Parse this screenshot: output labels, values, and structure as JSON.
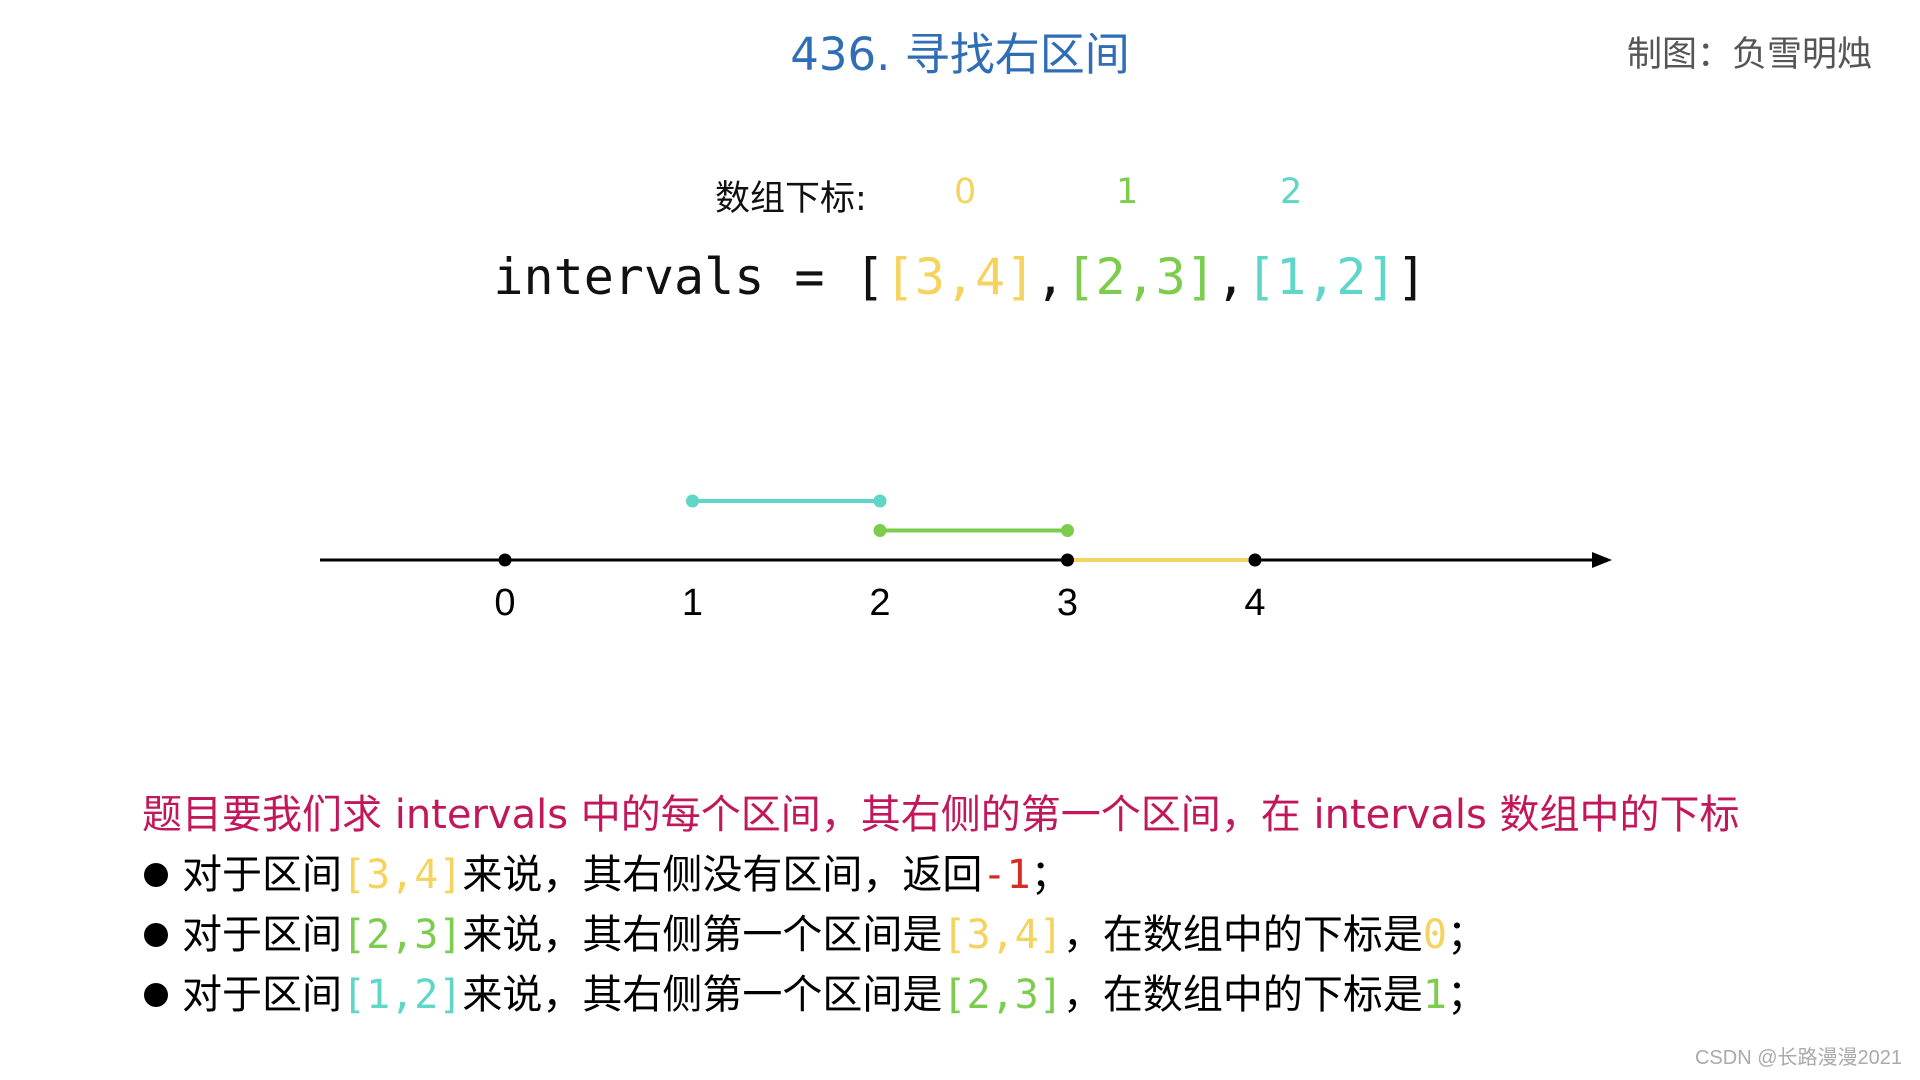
{
  "header": {
    "title": "436. 寻找右区间",
    "author": "制图：负雪明烛"
  },
  "index_label": "数组下标:",
  "indices": [
    "0",
    "1",
    "2"
  ],
  "expression": {
    "prefix": "intervals = [",
    "intervals": [
      "[3,4]",
      "[2,3]",
      "[1,2]"
    ],
    "separator": ",",
    "suffix": "]"
  },
  "colors": {
    "title": "#2f6db5",
    "interval_0": "#f4d35e",
    "interval_1": "#7ccc4d",
    "interval_2": "#5fd6c7",
    "heading": "#c2185b",
    "negative": "#d62d20"
  },
  "number_line": {
    "ticks": [
      "0",
      "1",
      "2",
      "3",
      "4"
    ],
    "segments": [
      {
        "start": 3,
        "end": 4,
        "color": "#f4d35e"
      },
      {
        "start": 2,
        "end": 3,
        "color": "#7ccc4d"
      },
      {
        "start": 1,
        "end": 2,
        "color": "#5fd6c7"
      }
    ]
  },
  "description": {
    "heading": "题目要我们求 intervals 中的每个区间，其右侧的第一个区间，在 intervals 数组中的下标",
    "bullets": [
      {
        "p1": "对于区间 ",
        "iv": "[3,4]",
        "p2": " 来说，其右侧没有区间，返回 ",
        "ans": "-1",
        "end": "；"
      },
      {
        "p1": "对于区间 ",
        "iv": "[2,3]",
        "p2": " 来说，其右侧第一个区间是 ",
        "right_iv": "[3,4]",
        "p3": "，在数组中的下标是 ",
        "ans": "0",
        "end": "；"
      },
      {
        "p1": "对于区间 ",
        "iv": "[1,2]",
        "p2": " 来说，其右侧第一个区间是 ",
        "right_iv": "[2,3]",
        "p3": "，在数组中的下标是 ",
        "ans": "1",
        "end": "；"
      }
    ]
  },
  "watermark": "CSDN @长路漫漫2021"
}
